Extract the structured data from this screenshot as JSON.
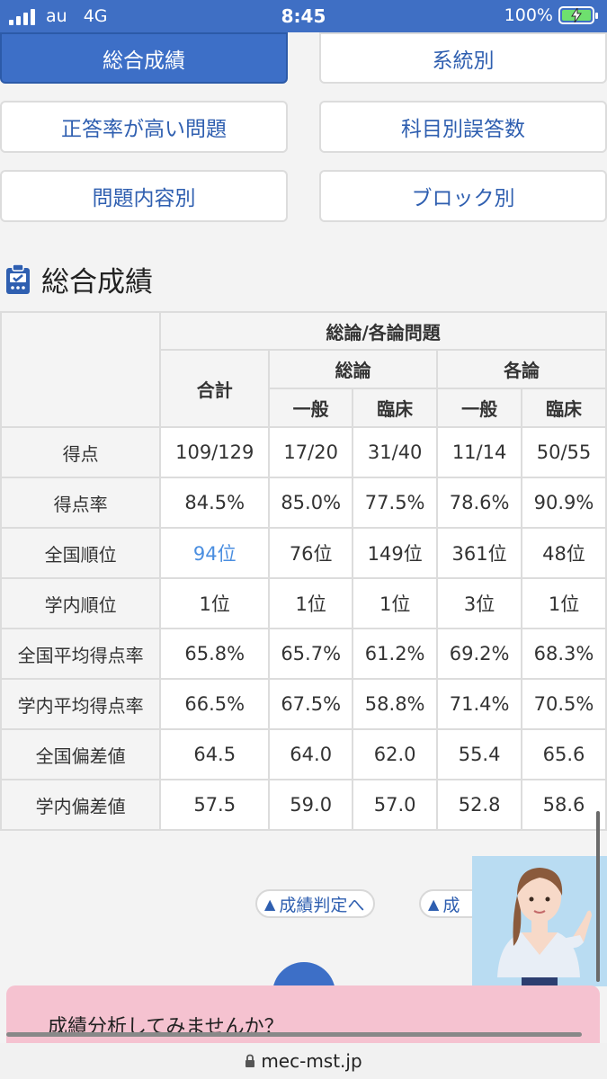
{
  "status_bar": {
    "carrier": "au",
    "network": "4G",
    "time": "8:45",
    "battery": "100%"
  },
  "nav": {
    "buttons": [
      {
        "label": "総合成績",
        "active": true
      },
      {
        "label": "系統別",
        "active": false
      },
      {
        "label": "正答率が高い問題",
        "active": false
      },
      {
        "label": "科目別誤答数",
        "active": false
      },
      {
        "label": "問題内容別",
        "active": false
      },
      {
        "label": "ブロック別",
        "active": false
      }
    ]
  },
  "section": {
    "title": "総合成績"
  },
  "table": {
    "group_header": "総論/各論問題",
    "total_header": "合計",
    "general_header": "総論",
    "specific_header": "各論",
    "sub_general_1": "一般",
    "sub_clinical_1": "臨床",
    "sub_general_2": "一般",
    "sub_clinical_2": "臨床",
    "rows": [
      {
        "label": "得点",
        "values": [
          "109/129",
          "17/20",
          "31/40",
          "11/14",
          "50/55"
        ]
      },
      {
        "label": "得点率",
        "values": [
          "84.5%",
          "85.0%",
          "77.5%",
          "78.6%",
          "90.9%"
        ]
      },
      {
        "label": "全国順位",
        "values": [
          "94位",
          "76位",
          "149位",
          "361位",
          "48位"
        ]
      },
      {
        "label": "学内順位",
        "values": [
          "1位",
          "1位",
          "1位",
          "3位",
          "1位"
        ]
      },
      {
        "label": "全国平均得点率",
        "values": [
          "65.8%",
          "65.7%",
          "61.2%",
          "69.2%",
          "68.3%"
        ]
      },
      {
        "label": "学内平均得点率",
        "values": [
          "66.5%",
          "67.5%",
          "58.8%",
          "71.4%",
          "70.5%"
        ]
      },
      {
        "label": "全国偏差値",
        "values": [
          "64.5",
          "64.0",
          "62.0",
          "55.4",
          "65.6"
        ]
      },
      {
        "label": "学内偏差値",
        "values": [
          "57.5",
          "59.0",
          "57.0",
          "52.8",
          "58.6"
        ]
      }
    ]
  },
  "links": {
    "judgement": "成績判定へ",
    "second": "成"
  },
  "banner": {
    "message": "成績分析してみませんか？"
  },
  "url_bar": {
    "domain": "mec-mst.jp"
  },
  "colors": {
    "primary": "#3d6fc7",
    "link": "#4a8ee0",
    "banner": "#f5c2d0"
  }
}
